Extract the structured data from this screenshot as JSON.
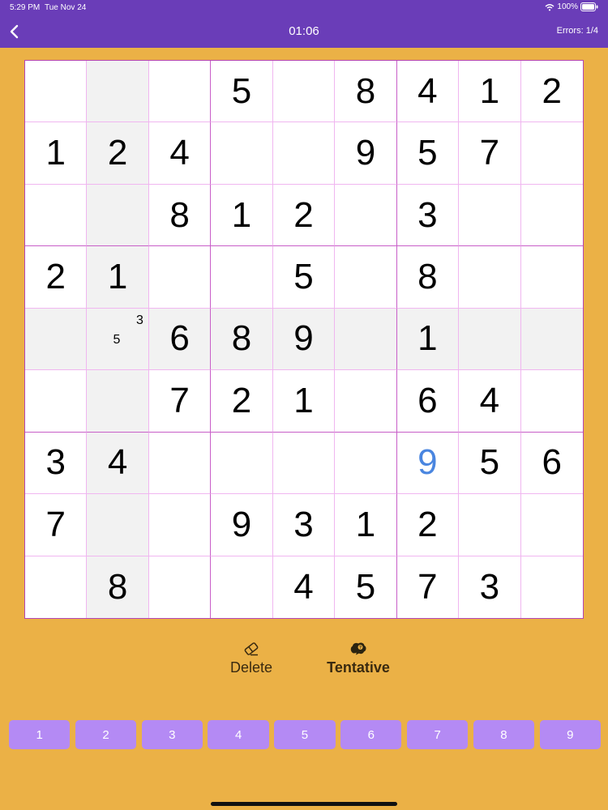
{
  "status_bar": {
    "time": "5:29 PM",
    "date": "Tue Nov 24",
    "battery": "100%"
  },
  "header": {
    "timer": "01:06",
    "errors": "Errors: 1/4"
  },
  "grid": {
    "cells": [
      [
        "",
        "",
        "",
        "5",
        "",
        "8",
        "4",
        "1",
        "2"
      ],
      [
        "1",
        "2",
        "4",
        "",
        "",
        "9",
        "5",
        "7",
        ""
      ],
      [
        "",
        "",
        "8",
        "1",
        "2",
        "",
        "3",
        "",
        ""
      ],
      [
        "2",
        "1",
        "",
        "",
        "5",
        "",
        "8",
        "",
        ""
      ],
      [
        "",
        "",
        "6",
        "8",
        "9",
        "",
        "1",
        "",
        ""
      ],
      [
        "",
        "",
        "7",
        "2",
        "1",
        "",
        "6",
        "4",
        ""
      ],
      [
        "3",
        "4",
        "",
        "",
        "",
        "",
        "9",
        "5",
        "6"
      ],
      [
        "7",
        "",
        "",
        "9",
        "3",
        "1",
        "2",
        "",
        ""
      ],
      [
        "",
        "8",
        "",
        "",
        "4",
        "5",
        "7",
        "3",
        ""
      ]
    ],
    "notes": {
      "r4c1": [
        "3",
        "5"
      ]
    },
    "user_entered": [
      "r6c6"
    ],
    "highlighted_row": 4,
    "highlighted_col": 1
  },
  "tools": {
    "delete_label": "Delete",
    "tentative_label": "Tentative"
  },
  "number_pad": [
    "1",
    "2",
    "3",
    "4",
    "5",
    "6",
    "7",
    "8",
    "9"
  ],
  "colors": {
    "header_bg": "#6A3DB8",
    "page_bg": "#EBB146",
    "key_bg": "#B48AF4",
    "grid_line": "#C85EC8",
    "entered_digit": "#4A86E0",
    "highlight": "#F2F2F2"
  },
  "icons": {
    "back": "chevron-left-icon",
    "wifi": "wifi-icon",
    "battery": "battery-icon",
    "delete": "eraser-icon",
    "tentative": "brain-icon"
  }
}
